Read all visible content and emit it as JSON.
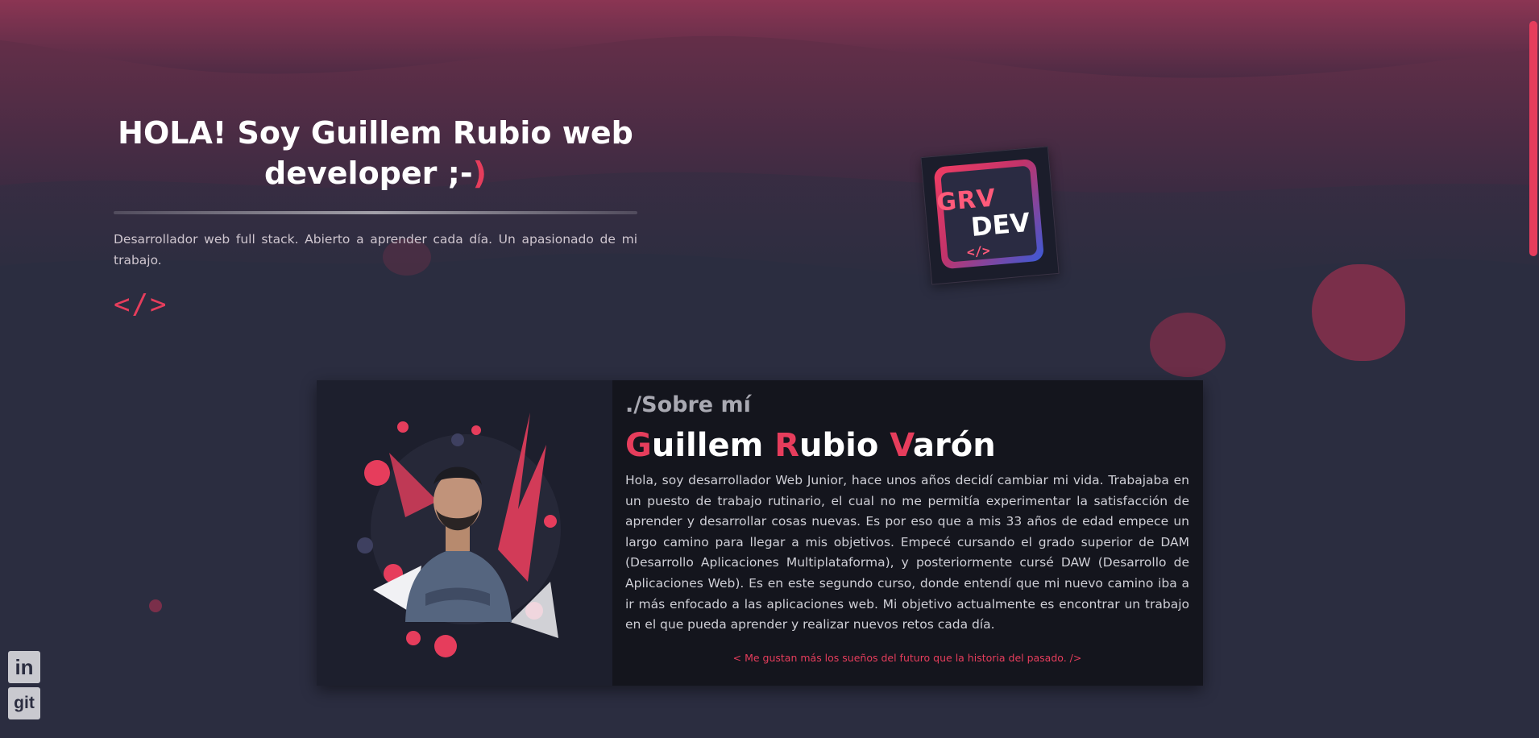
{
  "hero": {
    "title_main": "HOLA! Soy Guillem Rubio web developer ;-",
    "title_accent": ")",
    "subtitle": "Desarrollador web full stack. Abierto a aprender cada día. Un apasionado de mi trabajo.",
    "code_glyph": "</>"
  },
  "logo": {
    "line1": "GRV",
    "line2": "DEV",
    "code": "</>"
  },
  "about": {
    "section_tag": "./Sobre mí",
    "name_parts": [
      {
        "cap": "G",
        "rest": "uillem "
      },
      {
        "cap": "R",
        "rest": "ubio "
      },
      {
        "cap": "V",
        "rest": "arón"
      }
    ],
    "paragraph": "Hola, soy desarrollador Web Junior, hace unos años decidí cambiar mi vida. Trabajaba en un puesto de trabajo rutinario, el cual no me permitía experimentar la satisfacción de aprender y desarrollar cosas nuevas. Es por eso que a mis 33 años de edad empece un largo camino para llegar a mis objetivos. Empecé cursando el grado superior de DAM (Desarrollo Aplicaciones Multiplataforma), y posteriormente cursé DAW (Desarrollo de Aplicaciones Web). Es en este segundo curso, donde entendí que mi nuevo camino iba a ir más enfocado a las aplicaciones web. Mi objetivo actualmente es encontrar un trabajo en el que pueda aprender y realizar nuevos retos cada día.",
    "quote": "< Me gustan más los sueños del futuro que la historia del pasado. />"
  },
  "social": {
    "linkedin_label": "in",
    "git_label": "git",
    "icons": [
      "linkedin-icon",
      "git-icon"
    ]
  },
  "colors": {
    "accent": "#e63d5c",
    "background": "#2b2d40",
    "card": "#14151d"
  }
}
